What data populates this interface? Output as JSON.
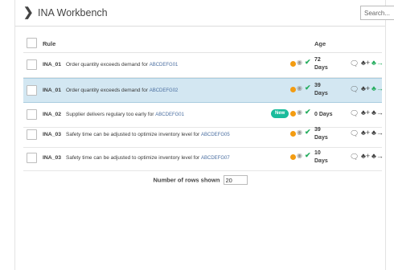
{
  "header": {
    "title": "INA Workbench",
    "search_placeholder": "Search..."
  },
  "table": {
    "col_rule": "Rule",
    "col_age": "Age",
    "rows": [
      {
        "id": "INA_01",
        "text": "Order quantity exceeds demand for",
        "code": "ABCDEFG01",
        "new": false,
        "age_line1": "72",
        "age_line2": "Days",
        "selected": false
      },
      {
        "id": "INA_01",
        "text": "Order quantity exceeds demand for",
        "code": "ABCDEFG02",
        "new": false,
        "age_line1": "39",
        "age_line2": "Days",
        "selected": true
      },
      {
        "id": "INA_02",
        "text": "Supplier delivers regulary too early for",
        "code": "ABCDEFG01",
        "new": true,
        "new_label": "New",
        "age_line1": "0 Days",
        "age_line2": "",
        "selected": false
      },
      {
        "id": "INA_03",
        "text": "Safety time can be adjusted to optimize inventory level for",
        "code": "ABCDEFG05",
        "new": false,
        "age_line1": "39",
        "age_line2": "Days",
        "selected": false
      },
      {
        "id": "INA_03",
        "text": "Safety time can be adjusted to optimize inventory level for",
        "code": "ABCDEFG07",
        "new": false,
        "age_line1": "10",
        "age_line2": "Days",
        "selected": false
      }
    ]
  },
  "footer": {
    "rows_shown_label": "Number of rows shown",
    "rows_shown_value": "20"
  },
  "colors": {
    "selected_row": "#d3e7f2",
    "status_orange": "#f39c12",
    "check_green": "#27ae60",
    "new_badge": "#1abc9c"
  },
  "icons": {
    "header": "chevron-right-icon",
    "status": [
      "orange-dot-icon",
      "eye-icon",
      "check-icon"
    ],
    "actions": [
      "comment-icon",
      "add-user-icon",
      "assign-user-icon"
    ]
  }
}
